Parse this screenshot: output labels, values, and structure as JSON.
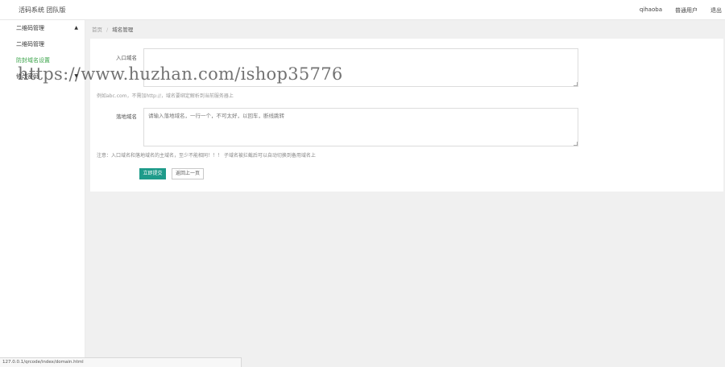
{
  "header": {
    "brand": "活码系统 团队版",
    "links": [
      "qihaoba",
      "普通用户",
      "退出"
    ]
  },
  "sidebar": {
    "group": {
      "label": "二维码管理",
      "arrow": "▲"
    },
    "items": [
      {
        "label": "二维码管理"
      },
      {
        "label": "防封域名设置"
      },
      {
        "label": "修改密码",
        "arrow": "▼"
      }
    ]
  },
  "breadcrumb": {
    "home": "首页",
    "separator": "/",
    "current": "域名管理"
  },
  "form": {
    "entry_domain": {
      "label": "入口域名",
      "value": "",
      "hint": "例如abc.com，不需加http://，域名要绑定解析到当前服务器上"
    },
    "landing_domain": {
      "label": "落地域名",
      "value": "",
      "placeholder": "请输入落地域名，一行一个，不可太好，以回车，断线跳转"
    },
    "note": "注意：入口域名和落地域名的主域名，至少不能相同！！！ 子域名被拦截后可以自动切换到备用域名上",
    "submit_label": "立即提交",
    "back_label": "返回上一页"
  },
  "watermark": "https://www.huzhan.com/ishop35776",
  "statusbar": {
    "url": "127.0.0.1/qrcode/index/domain.html"
  }
}
